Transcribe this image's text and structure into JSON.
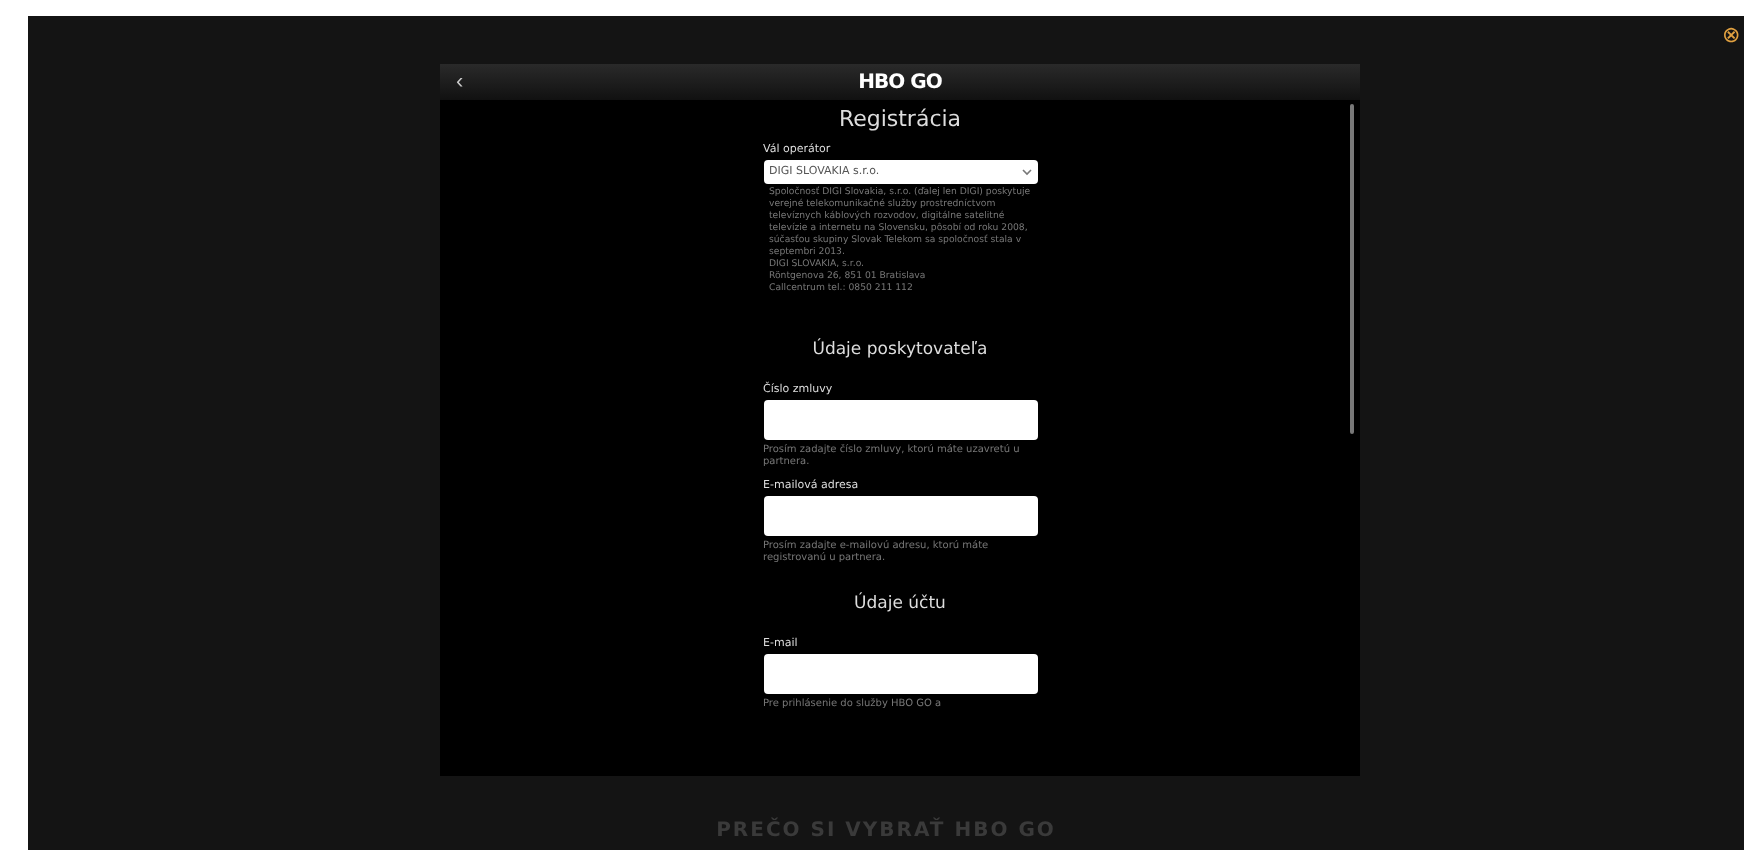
{
  "background": {
    "headline": "PREČO SI VYBRAŤ HBO GO"
  },
  "modal": {
    "back": "‹",
    "logo": "HBO GO",
    "title": "Registrácia",
    "operator": {
      "label": "Vál operátor",
      "value": "DIGI SLOVAKIA s.r.o.",
      "description": [
        "Spoločnosť DIGI Slovakia, s.r.o. (ďalej len DIGI) poskytuje verejné telekomunikačné služby prostredníctvom televíznych káblových rozvodov, digitálne satelitné televízie a internetu na Slovensku, pôsobí od roku 2008, súčasťou skupiny Slovak Telekom sa spoločnosť stala v septembri 2013.",
        "DIGI SLOVAKIA, s.r.o.",
        "Röntgenova 26, 851 01 Bratislava",
        "Callcentrum tel.: 0850 211 112"
      ]
    },
    "sections": [
      {
        "heading": "Údaje poskytovateľa",
        "fields": [
          {
            "label": "Číslo zmluvy",
            "hint": "Prosím zadajte číslo zmluvy, ktorú máte uzavretú u partnera."
          },
          {
            "label": "E-mailová adresa",
            "hint": "Prosím zadajte e-mailovú adresu, ktorú máte registrovanú u partnera."
          }
        ]
      },
      {
        "heading": "Údaje účtu",
        "fields": [
          {
            "label": "E-mail",
            "hint": "Pre prihlásenie do služby HBO GO a"
          }
        ]
      }
    ]
  },
  "close": "⊗"
}
